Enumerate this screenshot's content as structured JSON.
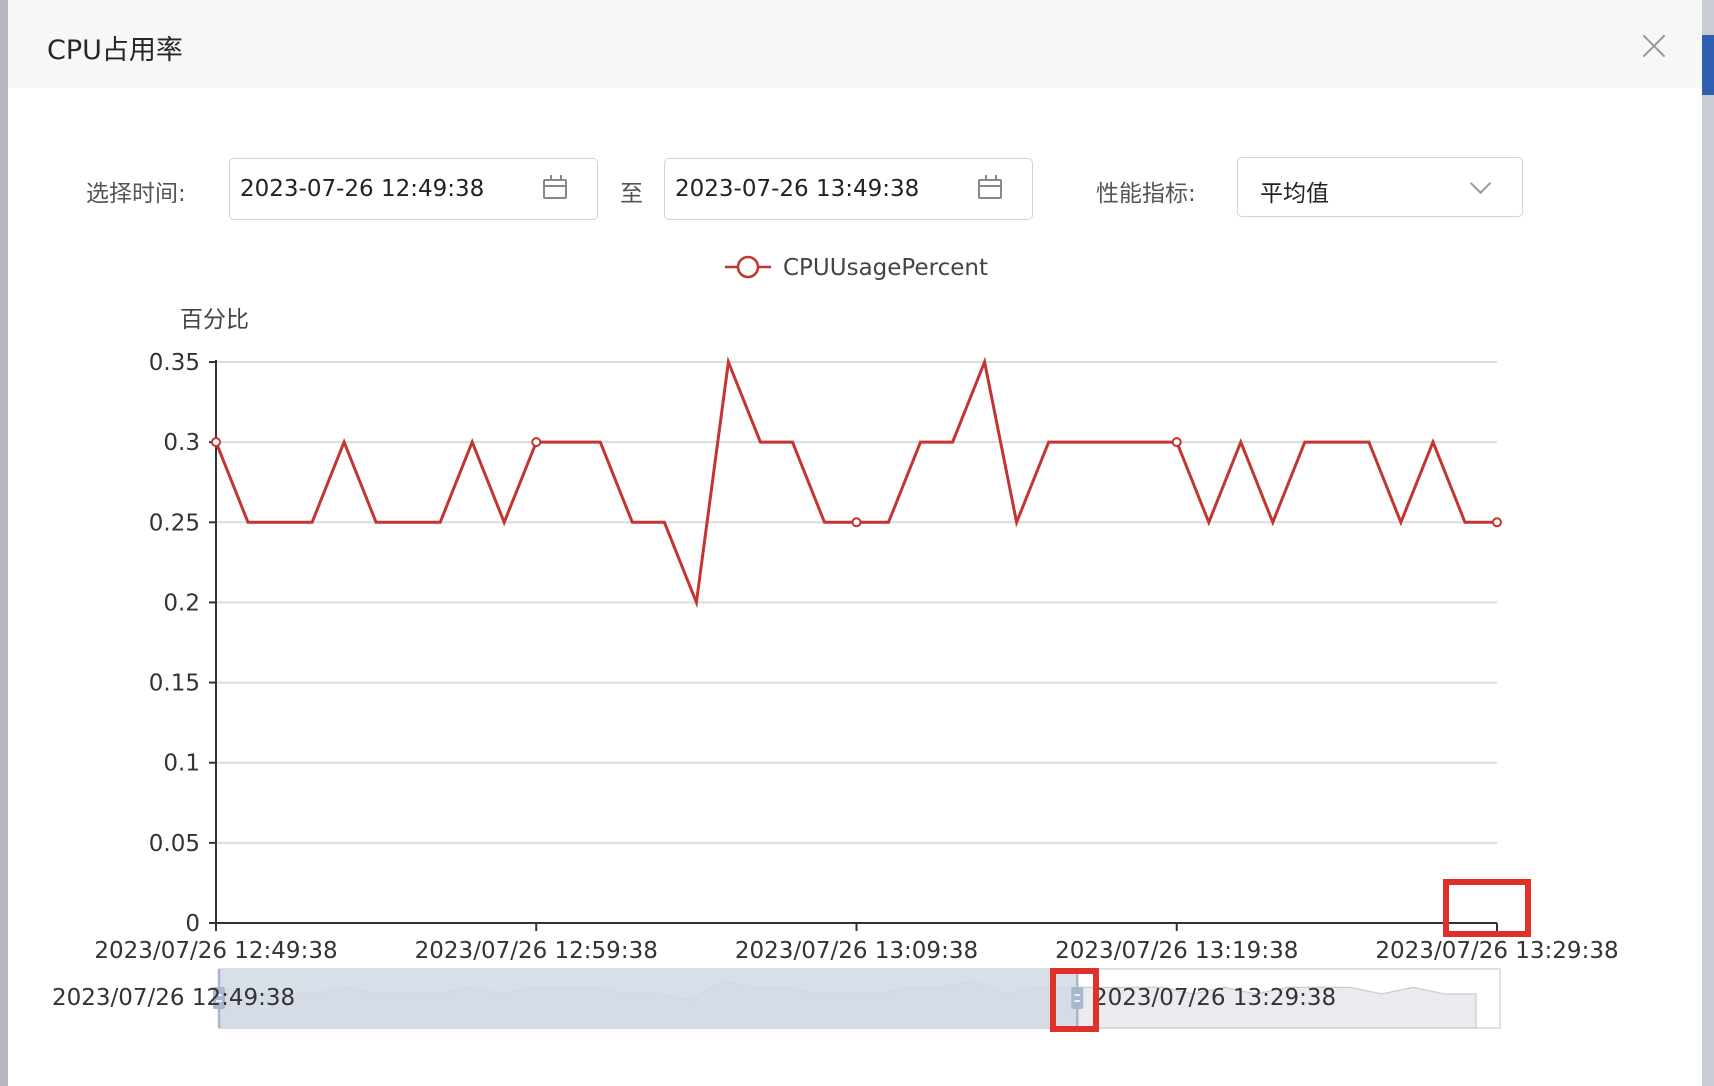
{
  "dialog": {
    "title": "CPU占用率"
  },
  "filters": {
    "time_label": "选择时间:",
    "start_time": "2023-07-26 12:49:38",
    "to_label": "至",
    "end_time": "2023-07-26 13:49:38",
    "metric_label": "性能指标:",
    "metric_value": "平均值"
  },
  "icons": {
    "close": "close-icon",
    "calendar": "calendar-icon",
    "dropdown": "chevron-down-icon"
  },
  "colors": {
    "series": "#c23531",
    "highlight": "#e0302a",
    "slider_fill": "#d2d9e4",
    "slider_handle": "#a7b7cc"
  },
  "chart_data": {
    "type": "line",
    "legend": [
      "CPUUsagePercent"
    ],
    "ylabel": "百分比",
    "ylim": [
      0,
      0.35
    ],
    "yticks": [
      "0",
      "0.05",
      "0.1",
      "0.15",
      "0.2",
      "0.25",
      "0.3",
      "0.35"
    ],
    "xticks": [
      "2023/07/26 12:49:38",
      "2023/07/26 12:59:38",
      "2023/07/26 13:09:38",
      "2023/07/26 13:19:38",
      "2023/07/26 13:29:38"
    ],
    "series": [
      {
        "name": "CPUUsagePercent",
        "values": [
          0.3,
          0.25,
          0.25,
          0.25,
          0.3,
          0.25,
          0.25,
          0.25,
          0.3,
          0.25,
          0.3,
          0.3,
          0.3,
          0.25,
          0.25,
          0.2,
          0.35,
          0.3,
          0.3,
          0.25,
          0.25,
          0.25,
          0.3,
          0.3,
          0.35,
          0.25,
          0.3,
          0.3,
          0.3,
          0.3,
          0.3,
          0.25,
          0.3,
          0.25,
          0.3,
          0.3,
          0.3,
          0.25,
          0.3,
          0.25,
          0.25
        ]
      }
    ],
    "grid": true,
    "datazoom": {
      "start_label": "2023/07/26 12:49:38",
      "end_label": "2023/07/26 13:29:38",
      "selected_end_fraction": 0.67
    }
  }
}
